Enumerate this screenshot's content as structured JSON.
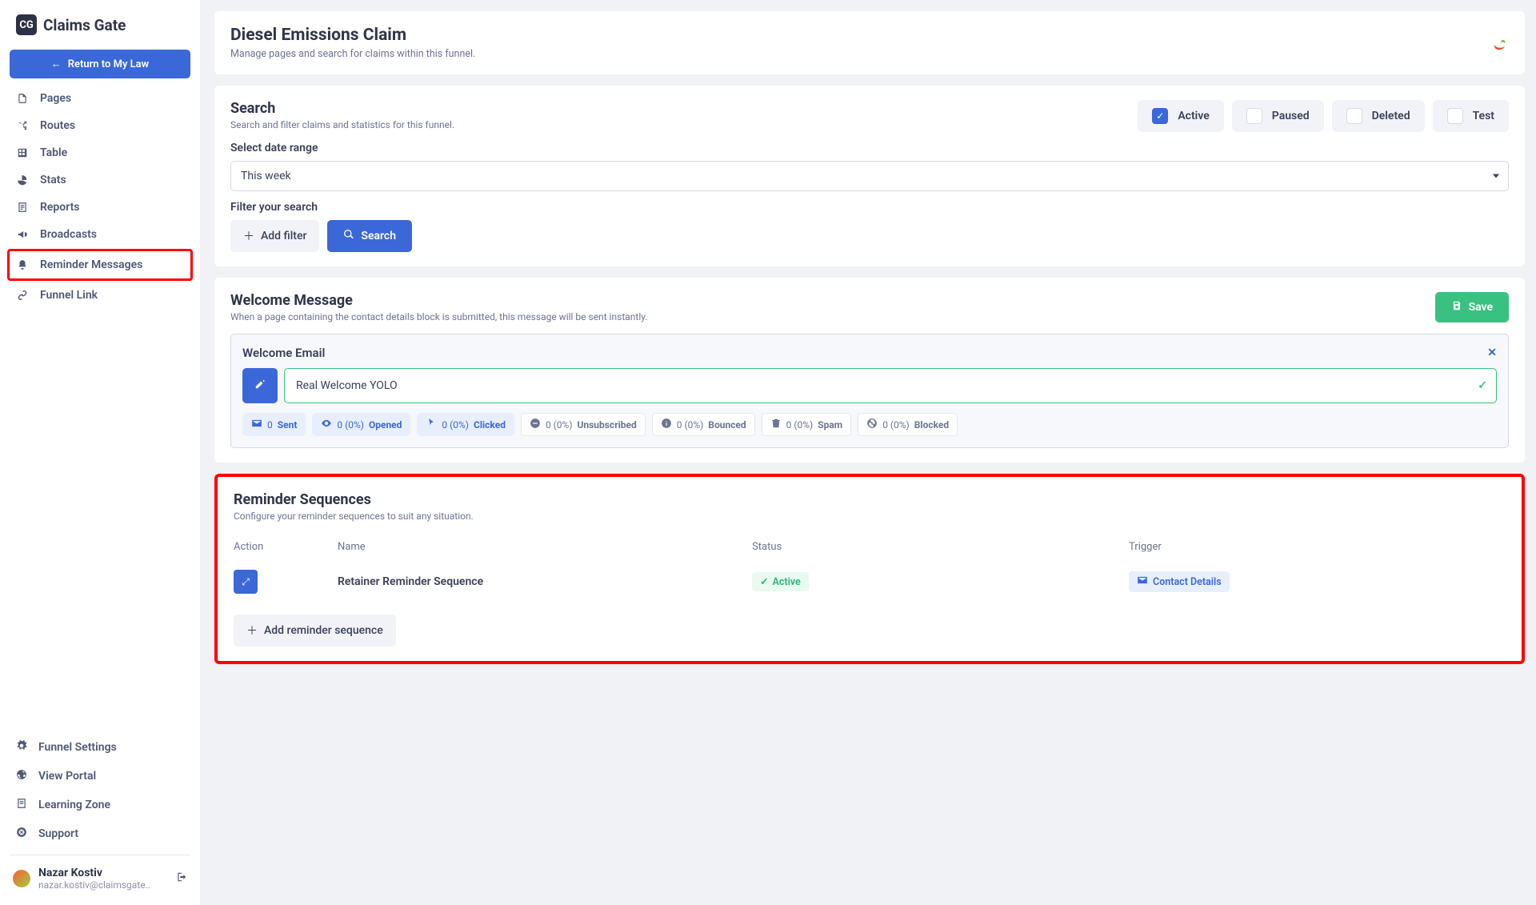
{
  "brand": {
    "name": "Claims Gate",
    "badge": "CG"
  },
  "return_btn": "Return to My Law",
  "nav": {
    "main": [
      {
        "label": "Pages"
      },
      {
        "label": "Routes"
      },
      {
        "label": "Table"
      },
      {
        "label": "Stats"
      },
      {
        "label": "Reports"
      },
      {
        "label": "Broadcasts"
      },
      {
        "label": "Reminder Messages",
        "highlighted": true
      },
      {
        "label": "Funnel Link"
      }
    ],
    "bottom": [
      {
        "label": "Funnel Settings"
      },
      {
        "label": "View Portal"
      },
      {
        "label": "Learning Zone"
      },
      {
        "label": "Support"
      }
    ]
  },
  "user": {
    "name": "Nazar Kostiv",
    "email": "nazar.kostiv@claimsgate.."
  },
  "header": {
    "title": "Diesel Emissions Claim",
    "subtitle": "Manage pages and search for claims within this funnel."
  },
  "search": {
    "title": "Search",
    "subtitle": "Search and filter claims and statistics for this funnel.",
    "statuses": [
      {
        "label": "Active",
        "checked": true
      },
      {
        "label": "Paused",
        "checked": false
      },
      {
        "label": "Deleted",
        "checked": false
      },
      {
        "label": "Test",
        "checked": false
      }
    ],
    "date_label": "Select date range",
    "date_value": "This week",
    "filter_label": "Filter your search",
    "add_filter": "Add filter",
    "search_btn": "Search"
  },
  "welcome": {
    "title": "Welcome Message",
    "subtitle": "When a page containing the contact details block is submitted, this message will be sent instantly.",
    "save": "Save",
    "panel_title": "Welcome Email",
    "email_value": "Real Welcome YOLO",
    "stats": [
      {
        "text": "0",
        "label": "Sent",
        "blue": true,
        "icon": "mail"
      },
      {
        "text": "0 (0%)",
        "label": "Opened",
        "blue": true,
        "icon": "eye"
      },
      {
        "text": "0 (0%)",
        "label": "Clicked",
        "blue": true,
        "icon": "cursor"
      },
      {
        "text": "0 (0%)",
        "label": "Unsubscribed",
        "blue": false,
        "icon": "minus"
      },
      {
        "text": "0 (0%)",
        "label": "Bounced",
        "blue": false,
        "icon": "info"
      },
      {
        "text": "0 (0%)",
        "label": "Spam",
        "blue": false,
        "icon": "trash"
      },
      {
        "text": "0 (0%)",
        "label": "Blocked",
        "blue": false,
        "icon": "ban"
      }
    ]
  },
  "sequences": {
    "title": "Reminder Sequences",
    "subtitle": "Configure your reminder sequences to suit any situation.",
    "cols": {
      "action": "Action",
      "name": "Name",
      "status": "Status",
      "trigger": "Trigger"
    },
    "rows": [
      {
        "name": "Retainer Reminder Sequence",
        "status": "Active",
        "trigger": "Contact Details"
      }
    ],
    "add_btn": "Add reminder sequence"
  }
}
